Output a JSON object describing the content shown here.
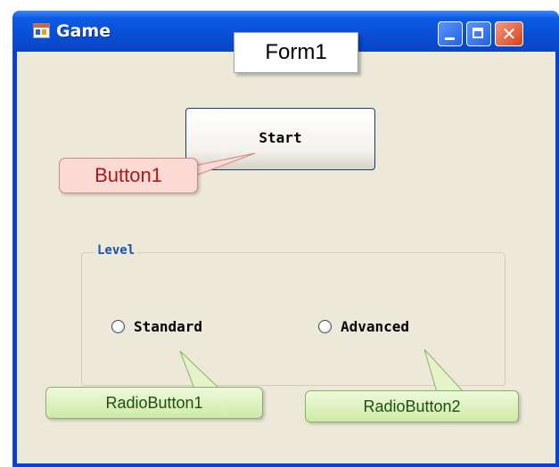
{
  "window": {
    "title": "Game",
    "icon": "form-app-icon",
    "controls": {
      "minimize": "minimize-icon",
      "maximize": "maximize-icon",
      "close": "close-icon"
    }
  },
  "callouts": {
    "form": "Form1",
    "button": "Button1",
    "radio1": "RadioButton1",
    "radio2": "RadioButton2"
  },
  "form": {
    "start_button_label": "Start",
    "group_label": "Level",
    "radios": [
      {
        "label": "Standard",
        "checked": false
      },
      {
        "label": "Advanced",
        "checked": false
      }
    ]
  },
  "colors": {
    "titlebar": "#0a4fd6",
    "client": "#ece9d8",
    "button1_callout": "#fbd9d4",
    "radio_callout": "#cfeaa7"
  }
}
